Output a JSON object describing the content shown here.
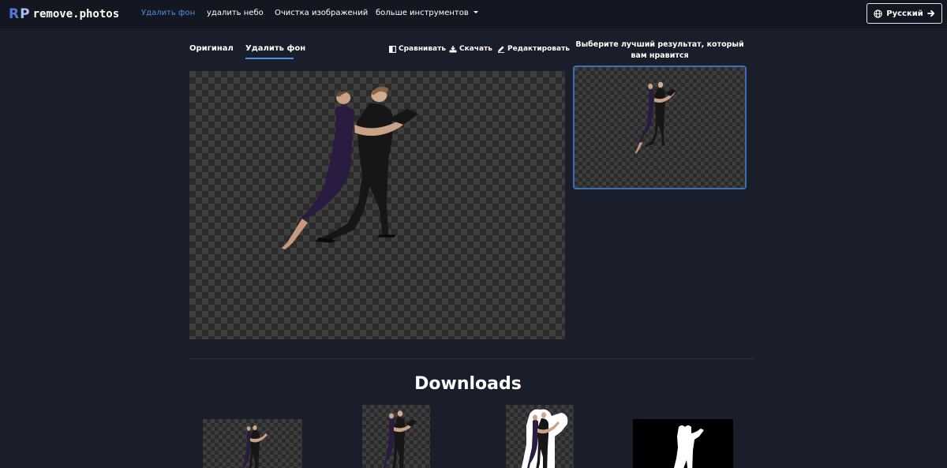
{
  "app": {
    "logo_text": "remove.photos",
    "logo_mark_r": "R",
    "logo_mark_p": "P"
  },
  "nav": {
    "items": [
      {
        "label": "Удалить фон",
        "active": true
      },
      {
        "label": "удалить небо",
        "active": false
      },
      {
        "label": "Очистка изображений",
        "active": false
      },
      {
        "label": "больше инструментов",
        "active": false,
        "dropdown": true
      }
    ]
  },
  "language": {
    "label": "Русский",
    "icon": "globe-icon",
    "arrow_icon": "arrow-right-icon"
  },
  "tabs": [
    {
      "label": "Оригинал",
      "active": false
    },
    {
      "label": "Удалить фон",
      "active": true
    }
  ],
  "toolbar": {
    "compare": {
      "label": "Сравнивать",
      "icon": "compare-icon"
    },
    "download": {
      "label": "Скачать",
      "icon": "download-icon"
    },
    "edit": {
      "label": "Редактировать",
      "icon": "edit-icon"
    }
  },
  "results": {
    "title": "Выберите лучший результат, который вам нравится"
  },
  "downloads": {
    "title": "Downloads"
  },
  "colors": {
    "background": "#1a1e2b",
    "header": "#141721",
    "accent": "#4a90e2",
    "selected_border": "#3d6fb8"
  }
}
